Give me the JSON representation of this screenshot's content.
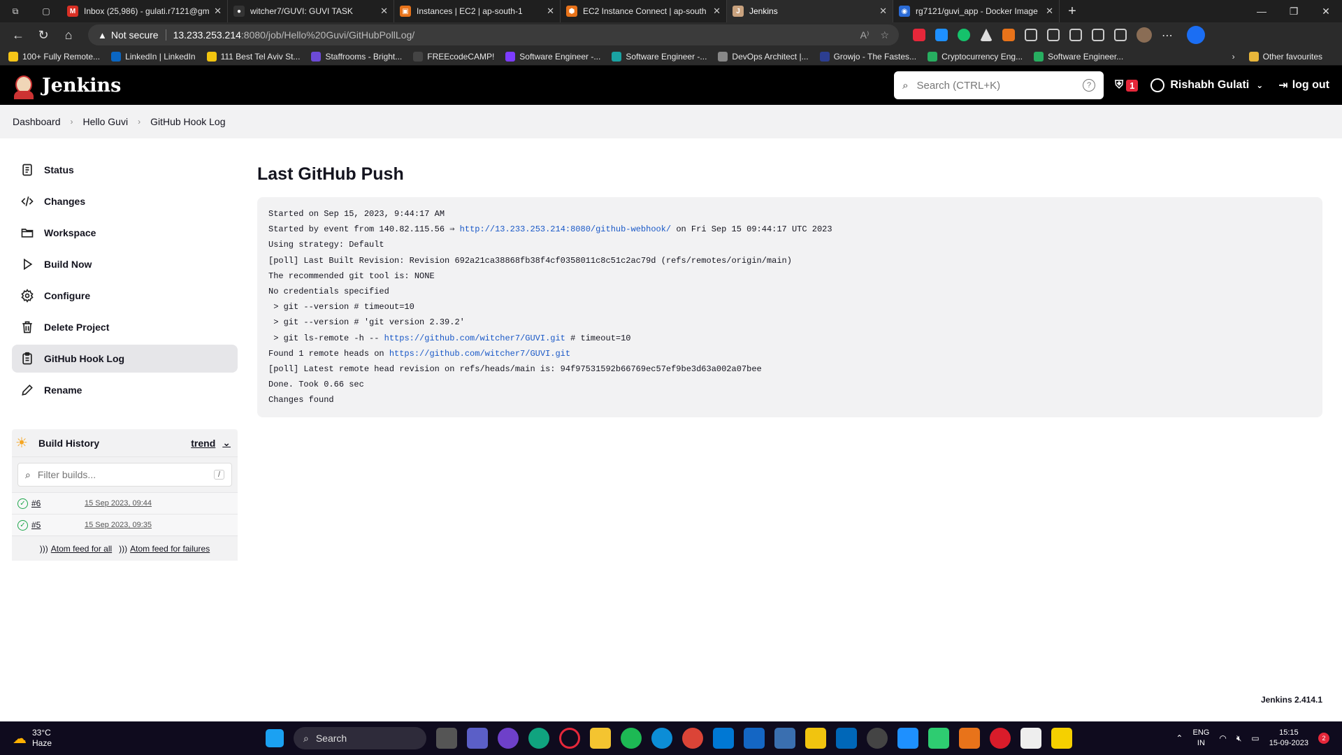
{
  "browser": {
    "tabs": [
      {
        "title": "Inbox (25,986) - gulati.r7121@gm",
        "color": "#d93025",
        "glyph": "M",
        "active": false
      },
      {
        "title": "witcher7/GUVI: GUVI TASK",
        "color": "#333333",
        "glyph": "●",
        "active": false
      },
      {
        "title": "Instances | EC2 | ap-south-1",
        "color": "#e8731a",
        "glyph": "▣",
        "active": false
      },
      {
        "title": "EC2 Instance Connect | ap-south",
        "color": "#e8731a",
        "glyph": "⬢",
        "active": false
      },
      {
        "title": "Jenkins",
        "color": "#c9a27e",
        "glyph": "J",
        "active": true
      },
      {
        "title": "rg7121/guvi_app - Docker Image",
        "color": "#2a6bd6",
        "glyph": "◉",
        "active": false
      }
    ],
    "address": {
      "security_label": "Not secure",
      "host": "13.233.253.214",
      "path": ":8080/job/Hello%20Guvi/GitHubPollLog/"
    },
    "bookmarks": [
      {
        "label": "100+ Fully Remote...",
        "color": "#f5c518"
      },
      {
        "label": "LinkedIn | LinkedIn",
        "color": "#0a66c2"
      },
      {
        "label": "111 Best Tel Aviv St...",
        "color": "#f1c40f"
      },
      {
        "label": "Staffrooms - Bright...",
        "color": "#6c4ad6"
      },
      {
        "label": "FREEcodeCAMP!",
        "color": "#444444"
      },
      {
        "label": "Software Engineer -...",
        "color": "#7d3cff"
      },
      {
        "label": "Software Engineer -...",
        "color": "#1aa3a3"
      },
      {
        "label": "DevOps Architect |...",
        "color": "#888888"
      },
      {
        "label": "Growjo - The Fastes...",
        "color": "#2c3e91"
      },
      {
        "label": "Cryptocurrency Eng...",
        "color": "#27ae60"
      },
      {
        "label": "Software Engineer...",
        "color": "#27ae60"
      }
    ],
    "other_favourites": "Other favourites"
  },
  "jenkins": {
    "brand": "Jenkins",
    "search_placeholder": "Search (CTRL+K)",
    "security_badge": "1",
    "user_name": "Rishabh Gulati",
    "logout_label": "log out",
    "breadcrumbs": [
      "Dashboard",
      "Hello Guvi",
      "GitHub Hook Log"
    ],
    "sidebar": [
      {
        "label": "Status",
        "icon": "document-icon",
        "active": false
      },
      {
        "label": "Changes",
        "icon": "code-icon",
        "active": false
      },
      {
        "label": "Workspace",
        "icon": "folder-icon",
        "active": false
      },
      {
        "label": "Build Now",
        "icon": "play-icon",
        "active": false
      },
      {
        "label": "Configure",
        "icon": "gear-icon",
        "active": false
      },
      {
        "label": "Delete Project",
        "icon": "trash-icon",
        "active": false
      },
      {
        "label": "GitHub Hook Log",
        "icon": "clipboard-icon",
        "active": true
      },
      {
        "label": "Rename",
        "icon": "pencil-icon",
        "active": false
      }
    ],
    "build_history": {
      "title": "Build History",
      "trend_label": "trend",
      "filter_placeholder": "Filter builds...",
      "filter_shortcut": "/",
      "builds": [
        {
          "number": "#6",
          "date": "15 Sep 2023, 09:44",
          "status": "success"
        },
        {
          "number": "#5",
          "date": "15 Sep 2023, 09:35",
          "status": "success"
        }
      ],
      "atom_all": "Atom feed for all",
      "atom_failures": "Atom feed for failures"
    },
    "page_title": "Last GitHub Push",
    "log_lines": [
      [
        {
          "t": "Started on Sep 15, 2023, 9:44:17 AM"
        }
      ],
      [
        {
          "t": "Started by event from 140.82.115.56 ⇒ "
        },
        {
          "t": "http://13.233.253.214:8080/github-webhook/",
          "link": true
        },
        {
          "t": " on Fri Sep 15 09:44:17 UTC 2023"
        }
      ],
      [
        {
          "t": "Using strategy: Default"
        }
      ],
      [
        {
          "t": "[poll] Last Built Revision: Revision 692a21ca38868fb38f4cf0358011c8c51c2ac79d (refs/remotes/origin/main)"
        }
      ],
      [
        {
          "t": "The recommended git tool is: NONE"
        }
      ],
      [
        {
          "t": "No credentials specified"
        }
      ],
      [
        {
          "t": " > git --version # timeout=10"
        }
      ],
      [
        {
          "t": " > git --version # 'git version 2.39.2'"
        }
      ],
      [
        {
          "t": " > git ls-remote -h -- "
        },
        {
          "t": "https://github.com/witcher7/GUVI.git",
          "link": true
        },
        {
          "t": " # timeout=10"
        }
      ],
      [
        {
          "t": "Found 1 remote heads on "
        },
        {
          "t": "https://github.com/witcher7/GUVI.git",
          "link": true
        }
      ],
      [
        {
          "t": "[poll] Latest remote head revision on refs/heads/main is: 94f97531592b66769ec57ef9be3d63a002a07bee"
        }
      ],
      [
        {
          "t": "Done. Took 0.66 sec"
        }
      ],
      [
        {
          "t": "Changes found"
        }
      ]
    ],
    "version": "Jenkins 2.414.1"
  },
  "taskbar": {
    "temperature": "33°C",
    "condition": "Haze",
    "search_label": "Search",
    "lang_top": "ENG",
    "lang_bottom": "IN",
    "time": "15:15",
    "date": "15-09-2023",
    "notification_count": "2"
  }
}
